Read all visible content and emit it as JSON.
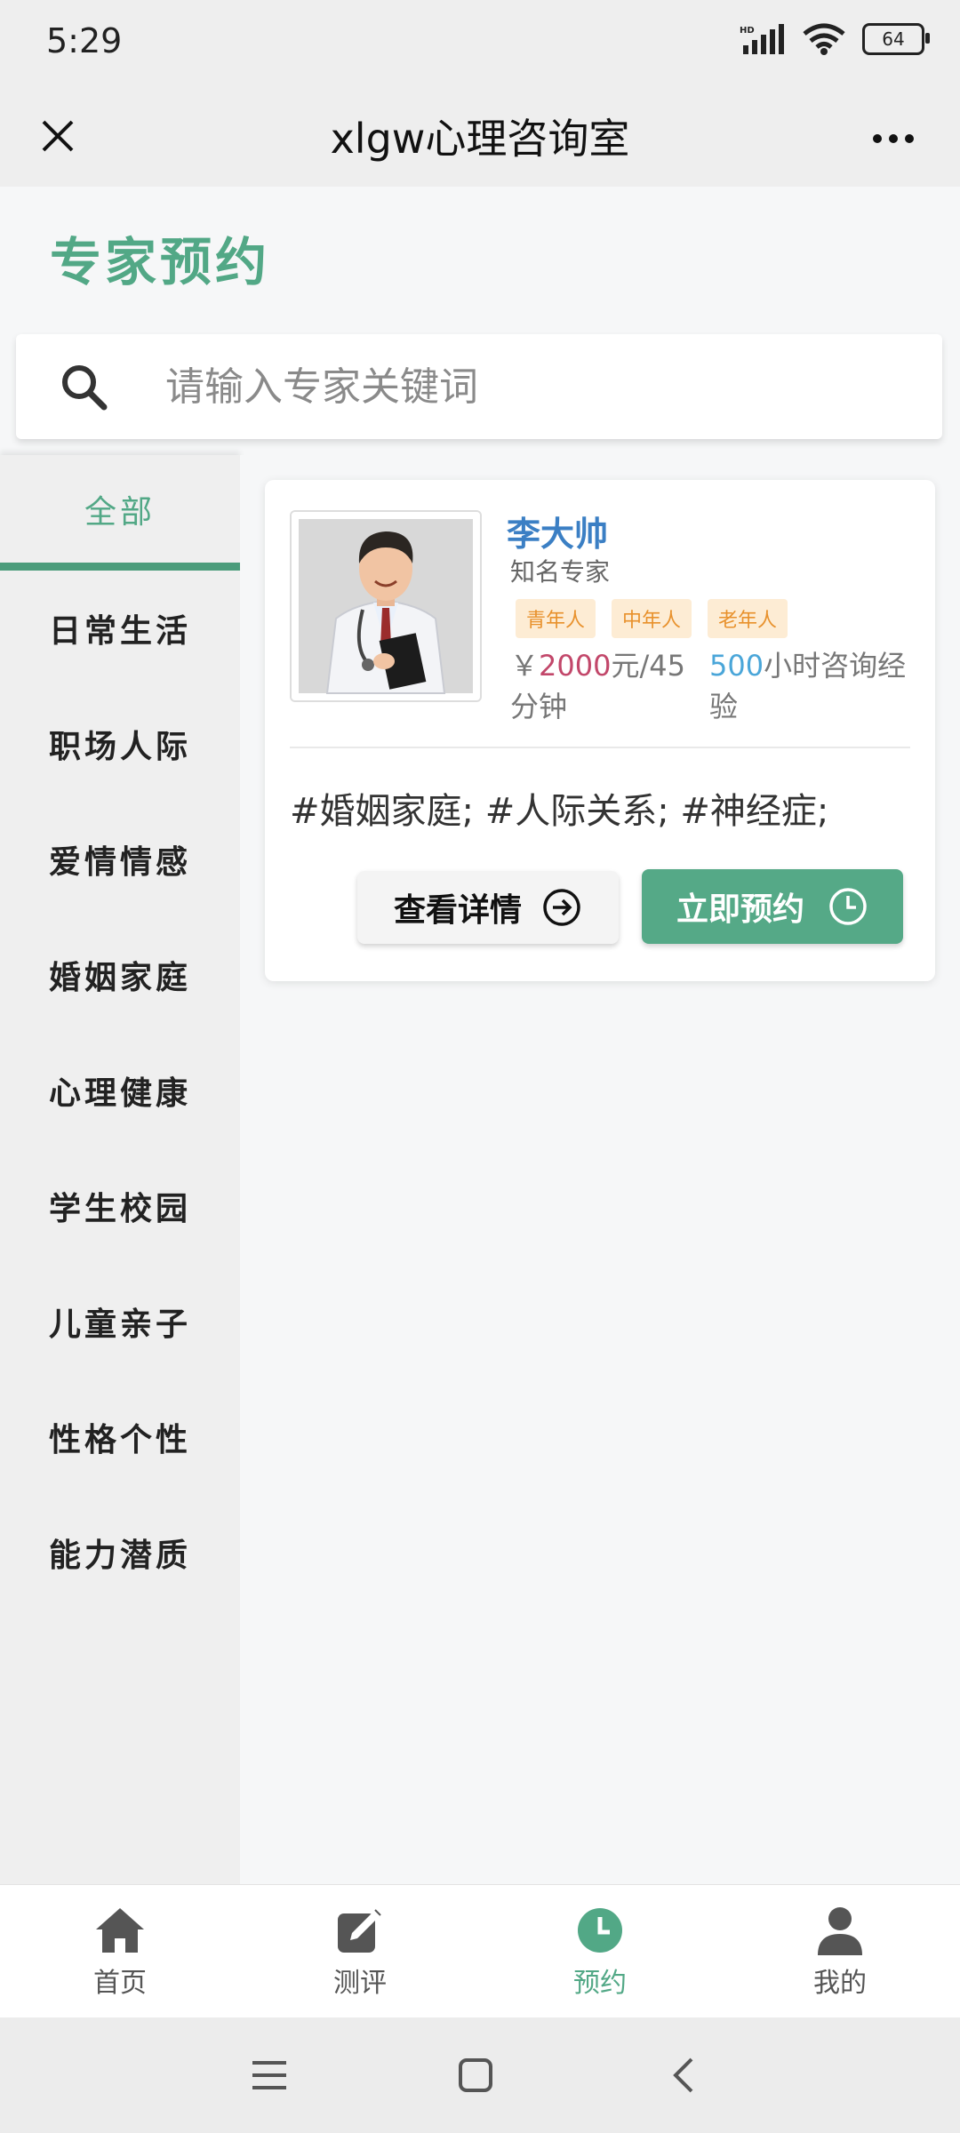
{
  "status_bar": {
    "time": "5:29",
    "battery": "64"
  },
  "title_bar": {
    "title": "xlgw心理咨询室"
  },
  "page": {
    "heading": "专家预约"
  },
  "search": {
    "placeholder": "请输入专家关键词"
  },
  "sidebar": {
    "items": [
      {
        "label": "全部",
        "active": true
      },
      {
        "label": "日常生活"
      },
      {
        "label": "职场人际"
      },
      {
        "label": "爱情情感"
      },
      {
        "label": "婚姻家庭"
      },
      {
        "label": "心理健康"
      },
      {
        "label": "学生校园"
      },
      {
        "label": "儿童亲子"
      },
      {
        "label": "性格个性"
      },
      {
        "label": "能力潜质"
      }
    ]
  },
  "expert": {
    "name": "李大帅",
    "title": "知名专家",
    "tags": [
      "青年人",
      "中年人",
      "老年人"
    ],
    "price_prefix": "￥",
    "price": "2000",
    "price_unit": "元/45分钟",
    "experience": "500",
    "experience_unit": "小时咨询经验",
    "specialties": "#婚姻家庭; #人际关系; #神经症;",
    "detail_button": "查看详情",
    "book_button": "立即预约"
  },
  "bottom_nav": {
    "items": [
      {
        "label": "首页",
        "icon": "home-icon"
      },
      {
        "label": "测评",
        "icon": "edit-icon"
      },
      {
        "label": "预约",
        "icon": "clock-icon",
        "active": true
      },
      {
        "label": "我的",
        "icon": "user-icon"
      }
    ]
  },
  "colors": {
    "accent": "#52a886",
    "name": "#3b7fc4",
    "price": "#c2476a",
    "experience": "#4aa6d9",
    "tag_bg": "#fdecd4",
    "tag_text": "#e8912c"
  }
}
